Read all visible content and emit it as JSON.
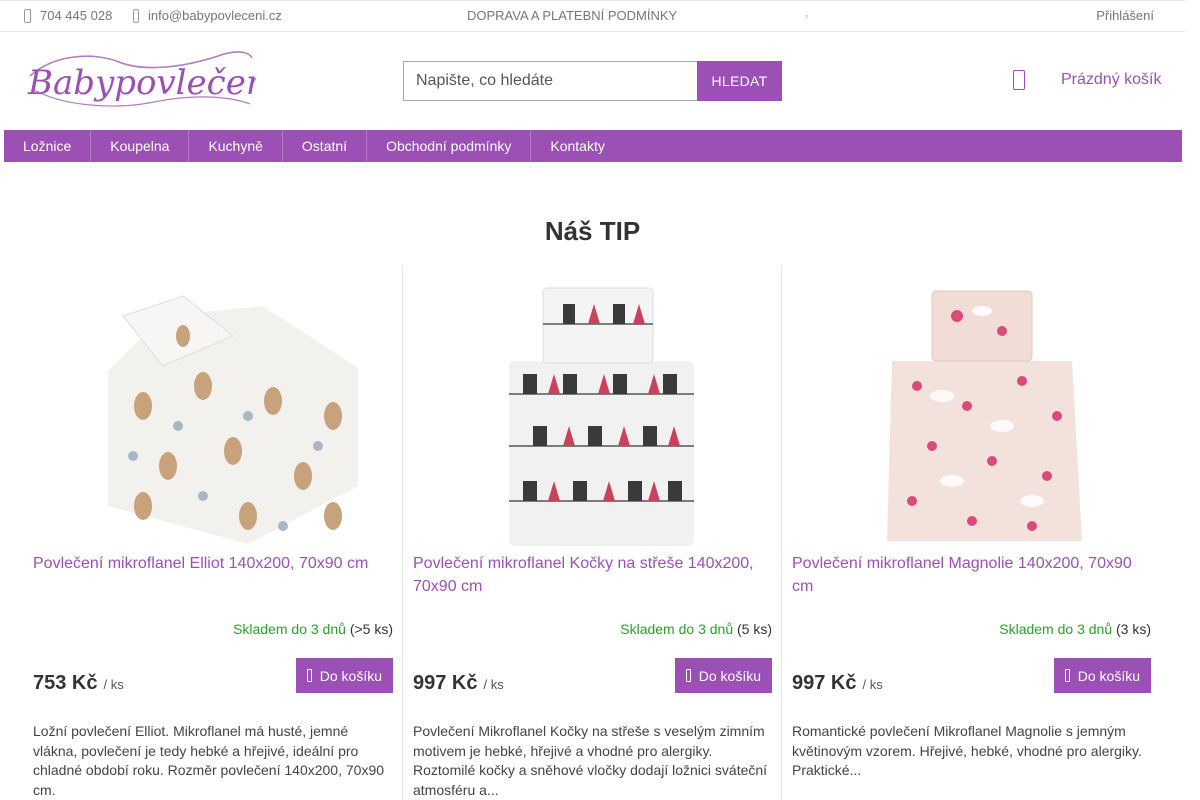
{
  "topbar": {
    "phone": "704 445 028",
    "email": "info@babypovleceni.cz",
    "shipping_link": "DOPRAVA A PLATEBNÍ PODMÍNKY",
    "login": "Přihlášení"
  },
  "header": {
    "logo_text": "Babypovlečení",
    "search": {
      "placeholder": "Napište, co hledáte",
      "button": "HLEDAT"
    },
    "cart_label": "Prázdný košík"
  },
  "nav": {
    "items": [
      {
        "label": "Ložnice"
      },
      {
        "label": "Koupelna"
      },
      {
        "label": "Kuchyně"
      },
      {
        "label": "Ostatní"
      },
      {
        "label": "Obchodní podmínky"
      },
      {
        "label": "Kontakty"
      }
    ]
  },
  "section_title": "Náš TIP",
  "products": [
    {
      "name": "Povlečení mikroflanel Elliot 140x200, 70x90 cm",
      "availability": "Skladem do 3 dnů",
      "stock_count": "(>5 ks)",
      "price": "753 Kč",
      "unit": "/ ks",
      "button": "Do košíku",
      "description": "Ložní povlečení Elliot. Mikroflanel má husté, jemné vlákna, povlečení je tedy hebké a hřejivé, ideální pro chladné období roku. Rozměr povlečení 140x200, 70x90 cm."
    },
    {
      "name": "Povlečení mikroflanel Kočky na střeše 140x200, 70x90 cm",
      "availability": "Skladem do 3 dnů",
      "stock_count": "(5 ks)",
      "price": "997 Kč",
      "unit": "/ ks",
      "button": "Do košíku",
      "description": "Povlečení Mikroflanel Kočky na střeše s veselým zimním motivem je hebké, hřejivé a vhodné pro alergiky. Roztomilé kočky a sněhové vločky dodají ložnici sváteční atmosféru a..."
    },
    {
      "name": "Povlečení mikroflanel Magnolie 140x200, 70x90 cm",
      "availability": "Skladem do 3 dnů",
      "stock_count": "(3 ks)",
      "price": "997 Kč",
      "unit": "/ ks",
      "button": "Do košíku",
      "description": "Romantické povlečení Mikroflanel Magnolie s jemným květinovým vzorem. Hřejivé, hebké, vhodné pro alergiky. Praktické..."
    }
  ],
  "colors": {
    "accent": "#9c50b6",
    "in_stock": "#2aa02a"
  },
  "icons": [
    "phone-icon",
    "mail-icon",
    "cart-icon",
    "cart-add-icon"
  ]
}
